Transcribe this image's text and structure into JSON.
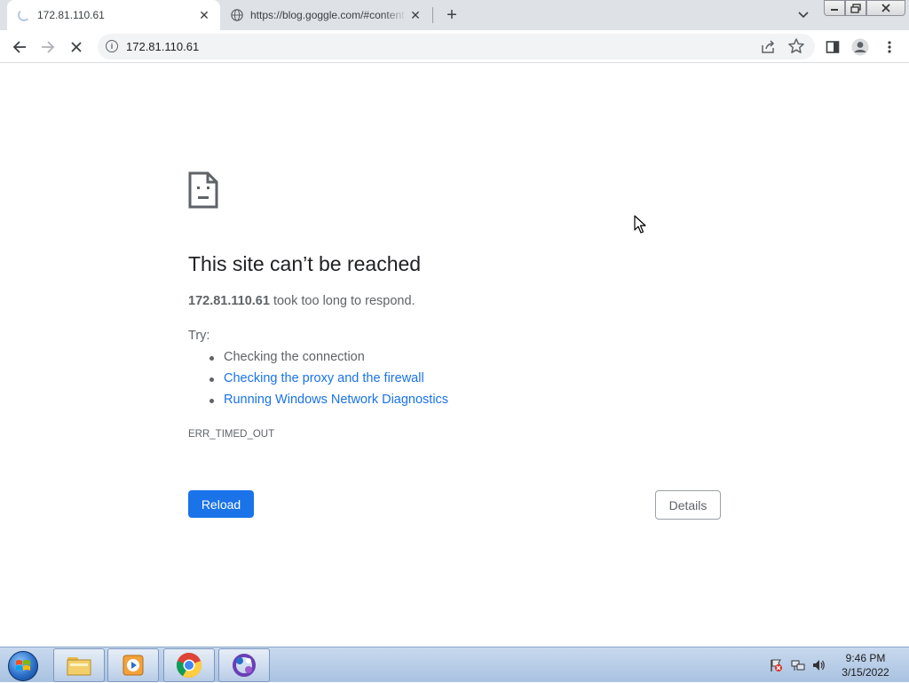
{
  "browser": {
    "tabs": [
      {
        "title": "172.81.110.61",
        "state": "loading",
        "active": true
      },
      {
        "title": "https://blog.goggle.com/#content",
        "state": "loaded",
        "active": false
      }
    ],
    "address_bar": {
      "url": "172.81.110.61"
    }
  },
  "error_page": {
    "title": "This site can’t be reached",
    "host": "172.81.110.61",
    "description_suffix": " took too long to respond.",
    "try_label": "Try:",
    "suggestions": [
      {
        "text": "Checking the connection",
        "is_link": false
      },
      {
        "text": "Checking the proxy and the firewall",
        "is_link": true
      },
      {
        "text": "Running Windows Network Diagnostics",
        "is_link": true
      }
    ],
    "error_code": "ERR_TIMED_OUT",
    "reload_label": "Reload",
    "details_label": "Details"
  },
  "taskbar": {
    "apps": [
      "file-explorer",
      "media-player",
      "chrome",
      "app-launcher"
    ],
    "clock_time": "9:46 PM",
    "clock_date": "3/15/2022"
  },
  "colors": {
    "link": "#1a73e8",
    "primary_button": "#1a73e8",
    "tabstrip": "#dee1e6"
  }
}
